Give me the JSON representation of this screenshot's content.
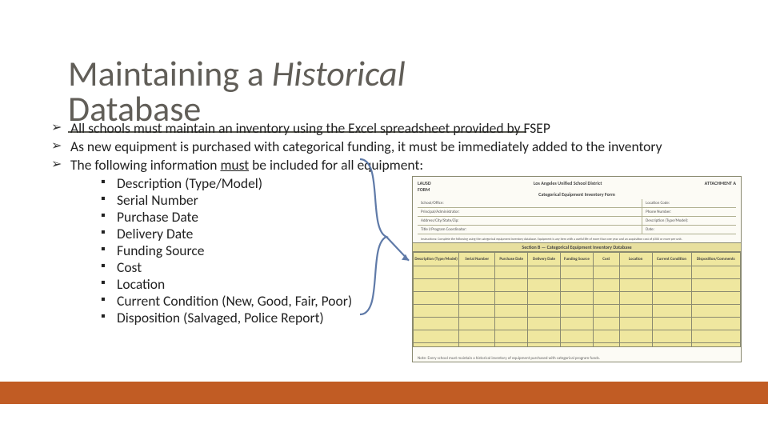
{
  "title": {
    "pre": "Maintaining a ",
    "italic": "Historical",
    "post": " Database"
  },
  "bullets": [
    "All schools must maintain an inventory using the Excel spreadsheet provided by FSEP",
    "As new equipment is purchased with categorical funding, it must be immediately added to the inventory",
    "The following information "
  ],
  "bullet3_underlined": "must",
  "bullet3_post": " be included for all equipment:",
  "subitems": [
    "Description (Type/Model)",
    "Serial Number",
    "Purchase Date",
    "Delivery Date",
    "Funding Source",
    "Cost",
    "Location",
    "Current Condition (New, Good, Fair, Poor)",
    "Disposition (Salvaged, Police Report)"
  ],
  "form": {
    "district": "Los Angeles Unified School District",
    "form_title": "Categorical Equipment Inventory Form",
    "attachment": "ATTACHMENT A",
    "location_code": "Location Code:",
    "phone": "Phone Number:",
    "principal": "Principal/Administrator:",
    "person_model": "Description (Type/Model):",
    "coord": "Title I/Program Coordinator:",
    "date": "Date:",
    "band": "Section B — Categorical Equipment Inventory Database",
    "cols": [
      "Description (Type/Model)",
      "Serial Number",
      "Purchase Date",
      "Delivery Date",
      "Funding Source",
      "Cost",
      "Location",
      "Current Condition",
      "Disposition/Comments"
    ],
    "footer": "Note: Every school must maintain a historical inventory of equipment purchased with categorical program funds."
  }
}
